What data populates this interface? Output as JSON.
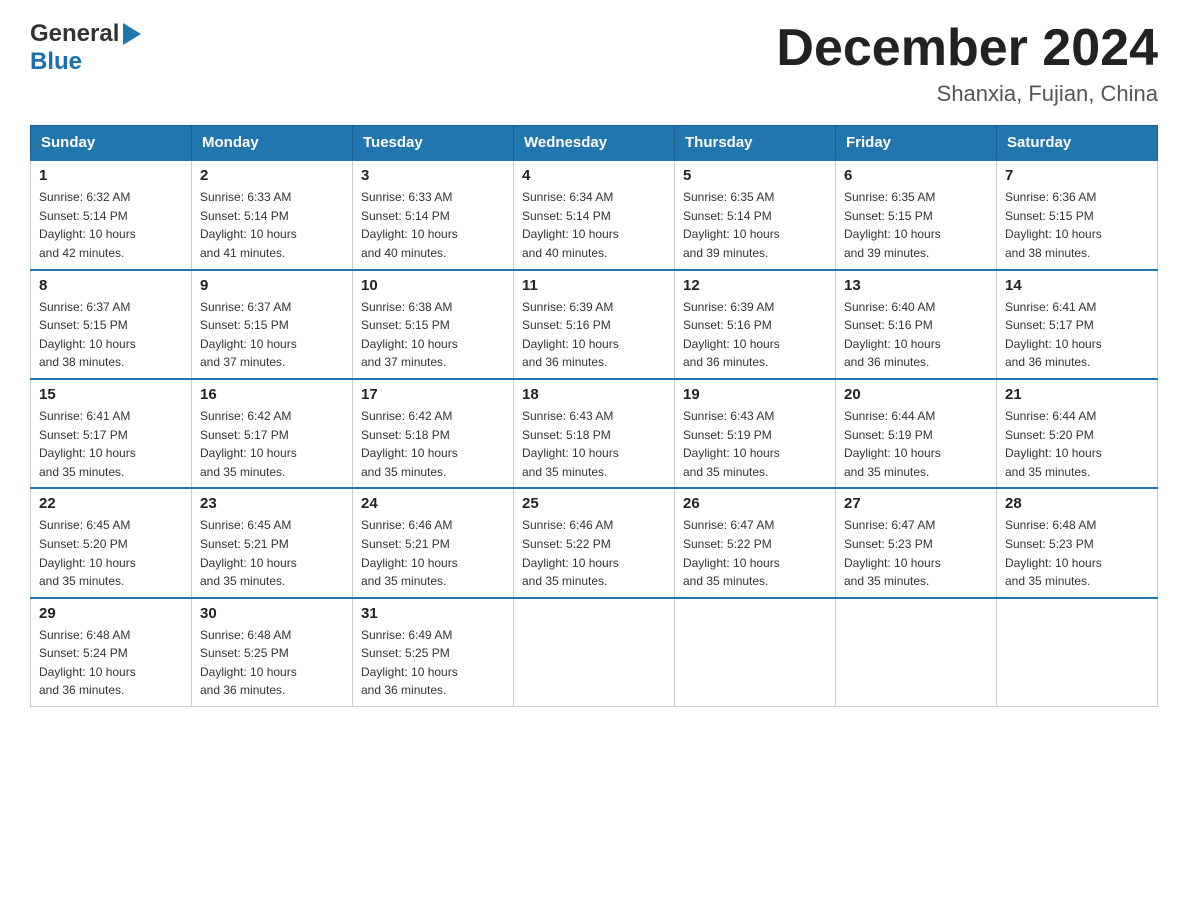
{
  "header": {
    "logo_general": "General",
    "logo_blue": "Blue",
    "month_title": "December 2024",
    "location": "Shanxia, Fujian, China"
  },
  "weekdays": [
    "Sunday",
    "Monday",
    "Tuesday",
    "Wednesday",
    "Thursday",
    "Friday",
    "Saturday"
  ],
  "weeks": [
    [
      {
        "day": "1",
        "sunrise": "6:32 AM",
        "sunset": "5:14 PM",
        "daylight": "10 hours and 42 minutes."
      },
      {
        "day": "2",
        "sunrise": "6:33 AM",
        "sunset": "5:14 PM",
        "daylight": "10 hours and 41 minutes."
      },
      {
        "day": "3",
        "sunrise": "6:33 AM",
        "sunset": "5:14 PM",
        "daylight": "10 hours and 40 minutes."
      },
      {
        "day": "4",
        "sunrise": "6:34 AM",
        "sunset": "5:14 PM",
        "daylight": "10 hours and 40 minutes."
      },
      {
        "day": "5",
        "sunrise": "6:35 AM",
        "sunset": "5:14 PM",
        "daylight": "10 hours and 39 minutes."
      },
      {
        "day": "6",
        "sunrise": "6:35 AM",
        "sunset": "5:15 PM",
        "daylight": "10 hours and 39 minutes."
      },
      {
        "day": "7",
        "sunrise": "6:36 AM",
        "sunset": "5:15 PM",
        "daylight": "10 hours and 38 minutes."
      }
    ],
    [
      {
        "day": "8",
        "sunrise": "6:37 AM",
        "sunset": "5:15 PM",
        "daylight": "10 hours and 38 minutes."
      },
      {
        "day": "9",
        "sunrise": "6:37 AM",
        "sunset": "5:15 PM",
        "daylight": "10 hours and 37 minutes."
      },
      {
        "day": "10",
        "sunrise": "6:38 AM",
        "sunset": "5:15 PM",
        "daylight": "10 hours and 37 minutes."
      },
      {
        "day": "11",
        "sunrise": "6:39 AM",
        "sunset": "5:16 PM",
        "daylight": "10 hours and 36 minutes."
      },
      {
        "day": "12",
        "sunrise": "6:39 AM",
        "sunset": "5:16 PM",
        "daylight": "10 hours and 36 minutes."
      },
      {
        "day": "13",
        "sunrise": "6:40 AM",
        "sunset": "5:16 PM",
        "daylight": "10 hours and 36 minutes."
      },
      {
        "day": "14",
        "sunrise": "6:41 AM",
        "sunset": "5:17 PM",
        "daylight": "10 hours and 36 minutes."
      }
    ],
    [
      {
        "day": "15",
        "sunrise": "6:41 AM",
        "sunset": "5:17 PM",
        "daylight": "10 hours and 35 minutes."
      },
      {
        "day": "16",
        "sunrise": "6:42 AM",
        "sunset": "5:17 PM",
        "daylight": "10 hours and 35 minutes."
      },
      {
        "day": "17",
        "sunrise": "6:42 AM",
        "sunset": "5:18 PM",
        "daylight": "10 hours and 35 minutes."
      },
      {
        "day": "18",
        "sunrise": "6:43 AM",
        "sunset": "5:18 PM",
        "daylight": "10 hours and 35 minutes."
      },
      {
        "day": "19",
        "sunrise": "6:43 AM",
        "sunset": "5:19 PM",
        "daylight": "10 hours and 35 minutes."
      },
      {
        "day": "20",
        "sunrise": "6:44 AM",
        "sunset": "5:19 PM",
        "daylight": "10 hours and 35 minutes."
      },
      {
        "day": "21",
        "sunrise": "6:44 AM",
        "sunset": "5:20 PM",
        "daylight": "10 hours and 35 minutes."
      }
    ],
    [
      {
        "day": "22",
        "sunrise": "6:45 AM",
        "sunset": "5:20 PM",
        "daylight": "10 hours and 35 minutes."
      },
      {
        "day": "23",
        "sunrise": "6:45 AM",
        "sunset": "5:21 PM",
        "daylight": "10 hours and 35 minutes."
      },
      {
        "day": "24",
        "sunrise": "6:46 AM",
        "sunset": "5:21 PM",
        "daylight": "10 hours and 35 minutes."
      },
      {
        "day": "25",
        "sunrise": "6:46 AM",
        "sunset": "5:22 PM",
        "daylight": "10 hours and 35 minutes."
      },
      {
        "day": "26",
        "sunrise": "6:47 AM",
        "sunset": "5:22 PM",
        "daylight": "10 hours and 35 minutes."
      },
      {
        "day": "27",
        "sunrise": "6:47 AM",
        "sunset": "5:23 PM",
        "daylight": "10 hours and 35 minutes."
      },
      {
        "day": "28",
        "sunrise": "6:48 AM",
        "sunset": "5:23 PM",
        "daylight": "10 hours and 35 minutes."
      }
    ],
    [
      {
        "day": "29",
        "sunrise": "6:48 AM",
        "sunset": "5:24 PM",
        "daylight": "10 hours and 36 minutes."
      },
      {
        "day": "30",
        "sunrise": "6:48 AM",
        "sunset": "5:25 PM",
        "daylight": "10 hours and 36 minutes."
      },
      {
        "day": "31",
        "sunrise": "6:49 AM",
        "sunset": "5:25 PM",
        "daylight": "10 hours and 36 minutes."
      },
      null,
      null,
      null,
      null
    ]
  ],
  "labels": {
    "sunrise": "Sunrise:",
    "sunset": "Sunset:",
    "daylight": "Daylight:"
  }
}
